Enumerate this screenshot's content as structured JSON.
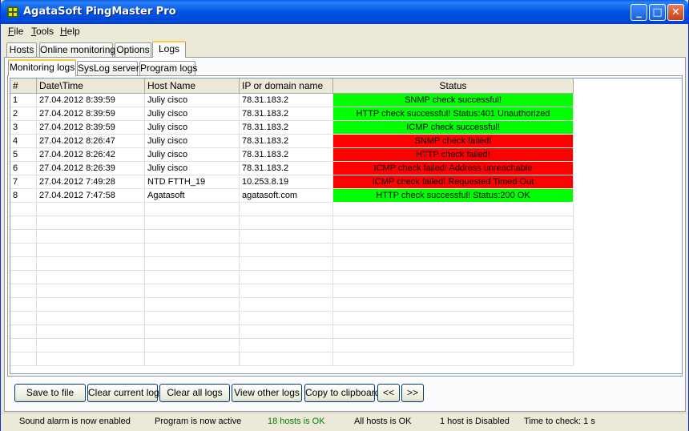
{
  "window": {
    "title": "AgataSoft PingMaster Pro"
  },
  "menu": [
    {
      "key": "F",
      "rest": "ile"
    },
    {
      "key": "T",
      "rest": "ools"
    },
    {
      "key": "H",
      "rest": "elp"
    }
  ],
  "main_tabs": [
    "Hosts",
    "Online monitoring",
    "Options",
    "Logs"
  ],
  "sub_tabs": [
    "Monitoring logs",
    "SysLog server",
    "Program logs"
  ],
  "columns": [
    "#",
    "Date\\Time",
    "Host Name",
    "IP or domain name",
    "Status"
  ],
  "rows": [
    {
      "n": "1",
      "dt": "27.04.2012 8:39:59",
      "host": "Juliy cisco",
      "ip": "78.31.183.2",
      "status": "SNMP check successful!",
      "ok": true
    },
    {
      "n": "2",
      "dt": "27.04.2012 8:39:59",
      "host": "Juliy cisco",
      "ip": "78.31.183.2",
      "status": "HTTP check successful! Status:401 Unauthorized",
      "ok": true
    },
    {
      "n": "3",
      "dt": "27.04.2012 8:39:59",
      "host": "Juliy cisco",
      "ip": "78.31.183.2",
      "status": "ICMP check successful!",
      "ok": true
    },
    {
      "n": "4",
      "dt": "27.04.2012 8:26:47",
      "host": "Juliy cisco",
      "ip": "78.31.183.2",
      "status": "SNMP check failed!",
      "ok": false
    },
    {
      "n": "5",
      "dt": "27.04.2012 8:26:42",
      "host": "Juliy cisco",
      "ip": "78.31.183.2",
      "status": "HTTP check failed!",
      "ok": false
    },
    {
      "n": "6",
      "dt": "27.04.2012 8:26:39",
      "host": "Juliy cisco",
      "ip": "78.31.183.2",
      "status": "ICMP check failed! Address unreachable",
      "ok": false
    },
    {
      "n": "7",
      "dt": "27.04.2012 7:49:28",
      "host": "NTD FTTH_19",
      "ip": "10.253.8.19",
      "status": "ICMP check failed! Requested Timed Out",
      "ok": false
    },
    {
      "n": "8",
      "dt": "27.04.2012 7:47:58",
      "host": "Agatasoft",
      "ip": "agatasoft.com",
      "status": "HTTP check successful! Status:200 OK",
      "ok": true
    }
  ],
  "buttons": [
    "Save to file",
    "Clear current log",
    "Clear all logs",
    "View other logs",
    "Copy to clipboard",
    "<<",
    ">>"
  ],
  "statusbar": [
    "Sound alarm is now enabled",
    "Program is now active",
    "18 hosts is OK",
    "All hosts is OK",
    "1 host is Disabled",
    "Time to check: 1 s"
  ],
  "colors": {
    "ok": "#00ff00",
    "fail": "#ff0000",
    "hosts_ok_text": "#008000"
  },
  "icons": {
    "minimize": "minimize-icon",
    "maximize": "maximize-icon",
    "close": "close-icon",
    "app": "app-icon"
  }
}
